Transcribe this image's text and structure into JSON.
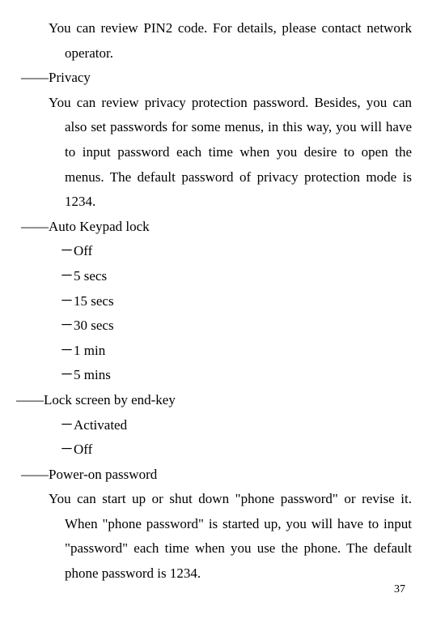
{
  "pin2_text": "You can review PIN2 code. For details, please contact network operator.",
  "privacy_heading": "――Privacy",
  "privacy_text": "You can review privacy protection password. Besides, you can also set passwords for some menus, in this way, you will have to input password each time when you desire to open the menus. The default password of privacy protection mode is 1234.",
  "auto_keypad_heading": "――Auto Keypad lock",
  "auto_keypad_options": {
    "opt1": "－Off",
    "opt2": "－5 secs",
    "opt3": "－15 secs",
    "opt4": "－30 secs",
    "opt5": "－1 min",
    "opt6": "－5 mins"
  },
  "lock_screen_heading": "――Lock screen by end-key",
  "lock_screen_options": {
    "opt1": "－Activated",
    "opt2": "－Off"
  },
  "poweron_heading": "――Power-on password",
  "poweron_text": "You can start up or shut down \"phone password\" or revise it. When \"phone password\" is started up, you will have to input \"password\" each time when you use the phone. The default phone password is 1234.",
  "page_number": "37"
}
